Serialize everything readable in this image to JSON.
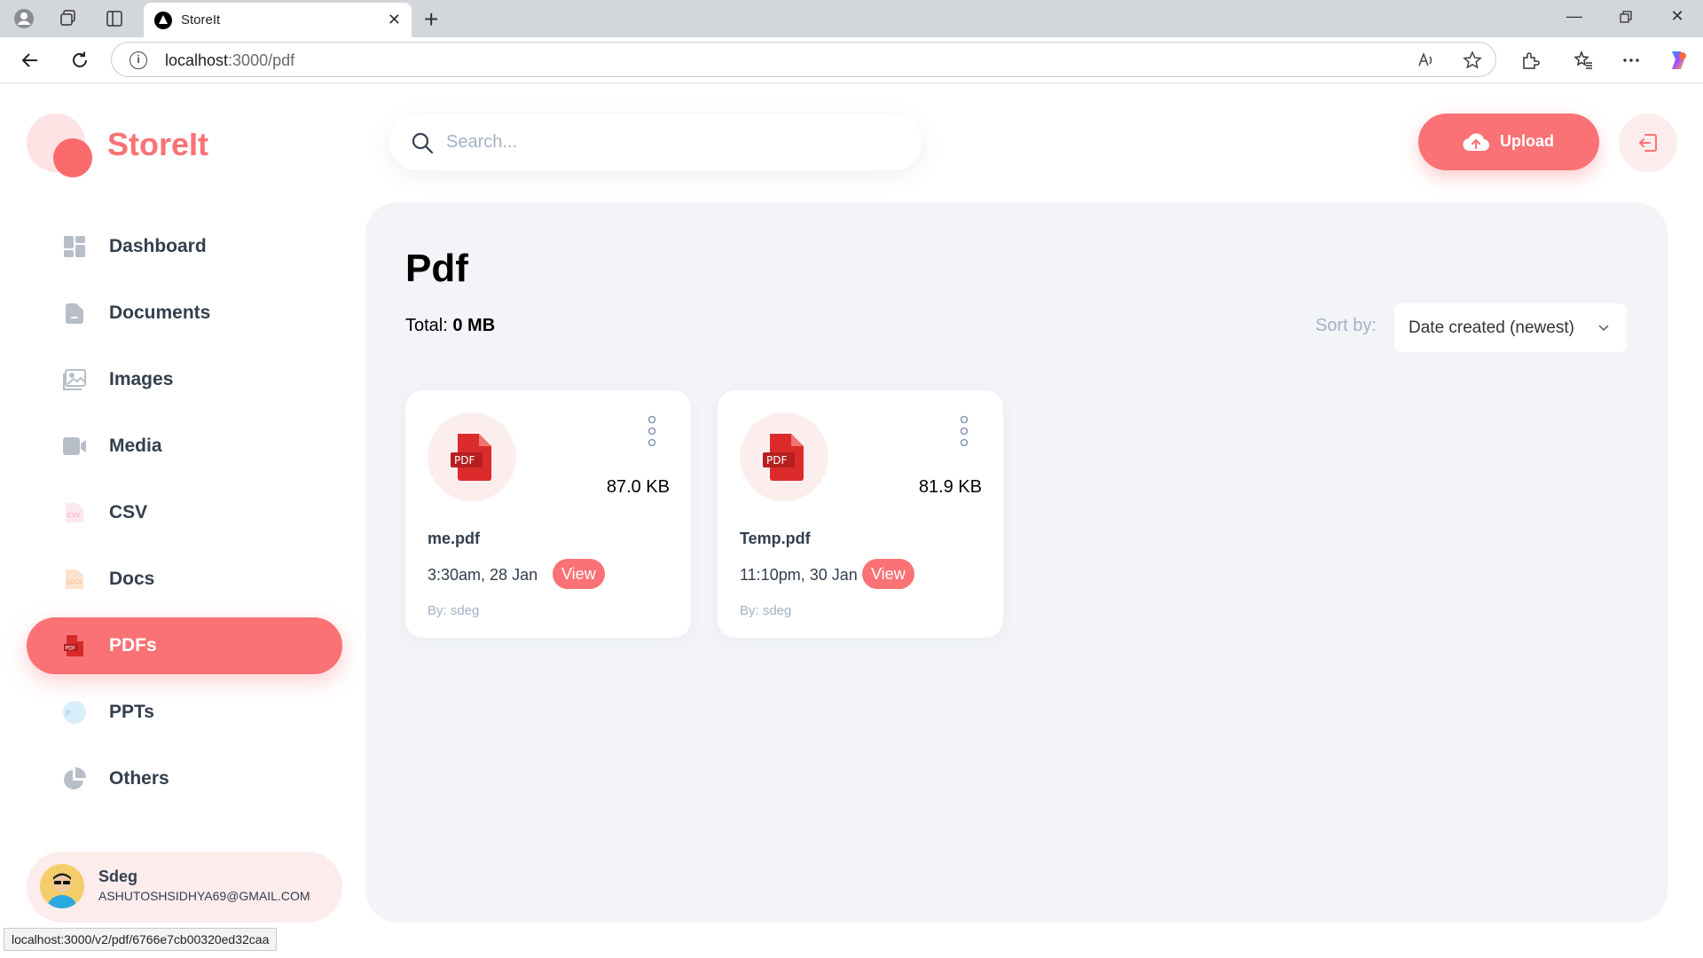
{
  "browser": {
    "tab_title": "StoreIt",
    "url_host": "localhost",
    "url_path": ":3000/pdf",
    "status_url": "localhost:3000/v2/pdf/6766e7cb00320ed32caa"
  },
  "app": {
    "brand": "StoreIt",
    "search_placeholder": "Search...",
    "upload_label": "Upload",
    "accent_color": "#fa7275"
  },
  "sidebar": {
    "items": [
      {
        "label": "Dashboard",
        "icon": "dashboard-icon"
      },
      {
        "label": "Documents",
        "icon": "documents-icon"
      },
      {
        "label": "Images",
        "icon": "images-icon"
      },
      {
        "label": "Media",
        "icon": "video-icon"
      },
      {
        "label": "CSV",
        "icon": "csv-icon"
      },
      {
        "label": "Docs",
        "icon": "docx-icon"
      },
      {
        "label": "PDFs",
        "icon": "pdf-icon",
        "active": true
      },
      {
        "label": "PPTs",
        "icon": "ppt-icon"
      },
      {
        "label": "Others",
        "icon": "pie-chart-icon"
      }
    ]
  },
  "user": {
    "name": "Sdeg",
    "email": "ASHUTOSHSIDHYA69@GMAIL.COM"
  },
  "page": {
    "title": "Pdf",
    "total_label": "Total:",
    "total_value": "0 MB",
    "sort_label": "Sort by:",
    "sort_value": "Date created (newest)"
  },
  "files": [
    {
      "name": "me.pdf",
      "size": "87.0 KB",
      "date": "3:30am, 28 Jan",
      "view": "View",
      "by": "By: sdeg"
    },
    {
      "name": "Temp.pdf",
      "size": "81.9 KB",
      "date": "11:10pm, 30 Jan",
      "view": "View",
      "by": "By: sdeg"
    }
  ]
}
